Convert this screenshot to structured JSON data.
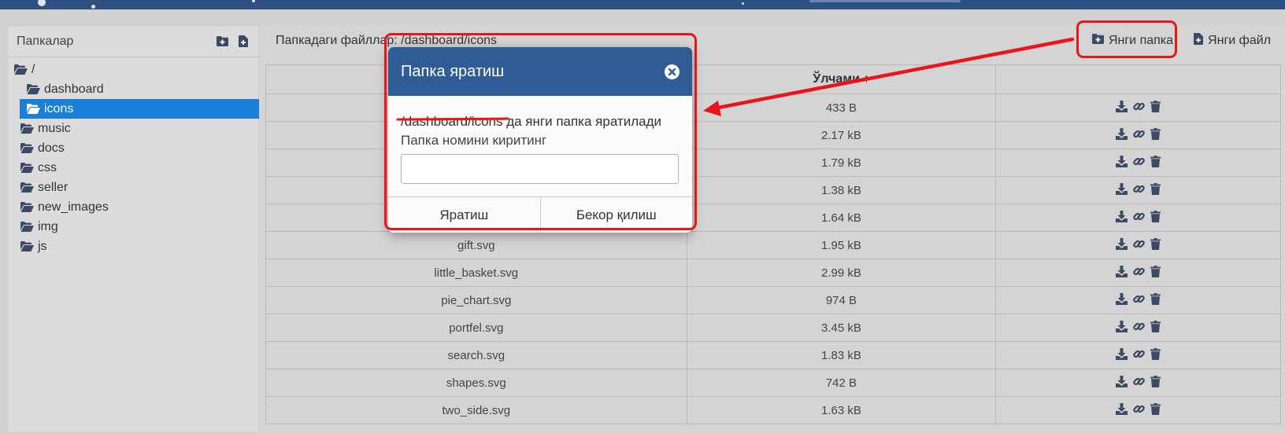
{
  "sidebar": {
    "title": "Папкалар",
    "icons": [
      "folder-plus-icon",
      "file-plus-icon"
    ],
    "items": [
      {
        "label": "/",
        "icon": "folder-open-icon"
      },
      {
        "label": "dashboard",
        "icon": "folder-open-icon"
      },
      {
        "label": "icons",
        "icon": "folder-open-icon",
        "active": true
      },
      {
        "label": "music",
        "icon": "folder-open-icon"
      },
      {
        "label": "docs",
        "icon": "folder-open-icon"
      },
      {
        "label": "css",
        "icon": "folder-open-icon"
      },
      {
        "label": "seller",
        "icon": "folder-open-icon"
      },
      {
        "label": "new_images",
        "icon": "folder-open-icon"
      },
      {
        "label": "img",
        "icon": "folder-open-icon"
      },
      {
        "label": "js",
        "icon": "folder-open-icon"
      }
    ]
  },
  "main": {
    "header_text": "Папкадаги файллар: /dashboard/icons",
    "new_folder_label": "Янги папка",
    "new_file_label": "Янги файл",
    "table": {
      "columns": [
        "",
        "Ўлчами",
        ""
      ],
      "sort_indicator": "↑",
      "rows": [
        {
          "name": "",
          "size": "433 B"
        },
        {
          "name": "",
          "size": "2.17 kB"
        },
        {
          "name": "",
          "size": "1.79 kB"
        },
        {
          "name": "",
          "size": "1.38 kB"
        },
        {
          "name": "",
          "size": "1.64 kB"
        },
        {
          "name": "gift.svg",
          "size": "1.95 kB"
        },
        {
          "name": "little_basket.svg",
          "size": "2.99 kB"
        },
        {
          "name": "pie_chart.svg",
          "size": "974 B"
        },
        {
          "name": "portfel.svg",
          "size": "3.45 kB"
        },
        {
          "name": "search.svg",
          "size": "1.83 kB"
        },
        {
          "name": "shapes.svg",
          "size": "742 B"
        },
        {
          "name": "two_side.svg",
          "size": "1.63 kB"
        }
      ],
      "row_actions": [
        "download-icon",
        "link-icon",
        "trash-icon"
      ]
    }
  },
  "modal": {
    "title": "Папка яратиш",
    "path": "/dashboard/icons",
    "message_suffix": " да янги папка яратилади",
    "prompt": "Папка номини киритинг",
    "input_value": "",
    "create_label": "Яратиш",
    "cancel_label": "Бекор қилиш"
  },
  "colors": {
    "topbar": "#2e4f7f",
    "modal_header": "#2f5b96",
    "active_item": "#1a7fd8",
    "annotation": "#e8151b",
    "icon": "#3c4a66"
  }
}
